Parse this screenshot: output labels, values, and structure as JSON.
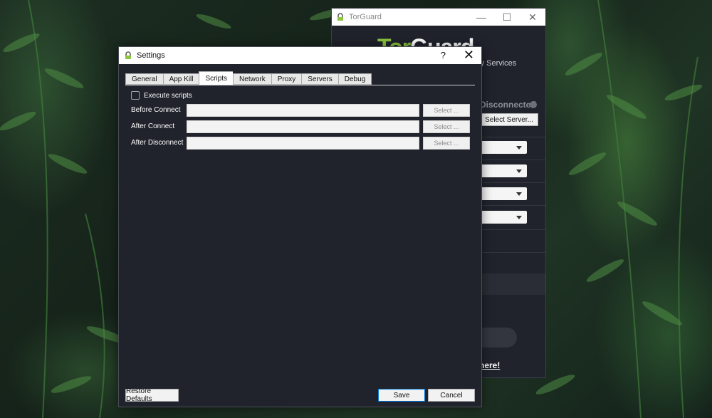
{
  "torguard_window": {
    "title": "TorGuard",
    "brand_tor": "Tor",
    "brand_guard": "Guard",
    "brand_sub": "Privacy Services",
    "status": "Disconnected",
    "select_server_label": "Select Server...",
    "link_text": "here!"
  },
  "settings": {
    "title": "Settings",
    "help": "?",
    "close": "✕",
    "tabs": [
      {
        "label": "General"
      },
      {
        "label": "App Kill"
      },
      {
        "label": "Scripts"
      },
      {
        "label": "Network"
      },
      {
        "label": "Proxy"
      },
      {
        "label": "Servers"
      },
      {
        "label": "Debug"
      }
    ],
    "active_tab": "Scripts",
    "execute_scripts": {
      "label": "Execute scripts",
      "checked": false
    },
    "rows": [
      {
        "label": "Before Connect",
        "value": "",
        "button": "Select ..."
      },
      {
        "label": "After Connect",
        "value": "",
        "button": "Select ..."
      },
      {
        "label": "After Disconnect",
        "value": "",
        "button": "Select ..."
      }
    ],
    "buttons": {
      "restore": "Restore Defaults",
      "save": "Save",
      "cancel": "Cancel"
    }
  },
  "colors": {
    "dialog_bg": "#20232c",
    "brand_green": "#8dc63f",
    "accent_focus": "#0078d7"
  }
}
